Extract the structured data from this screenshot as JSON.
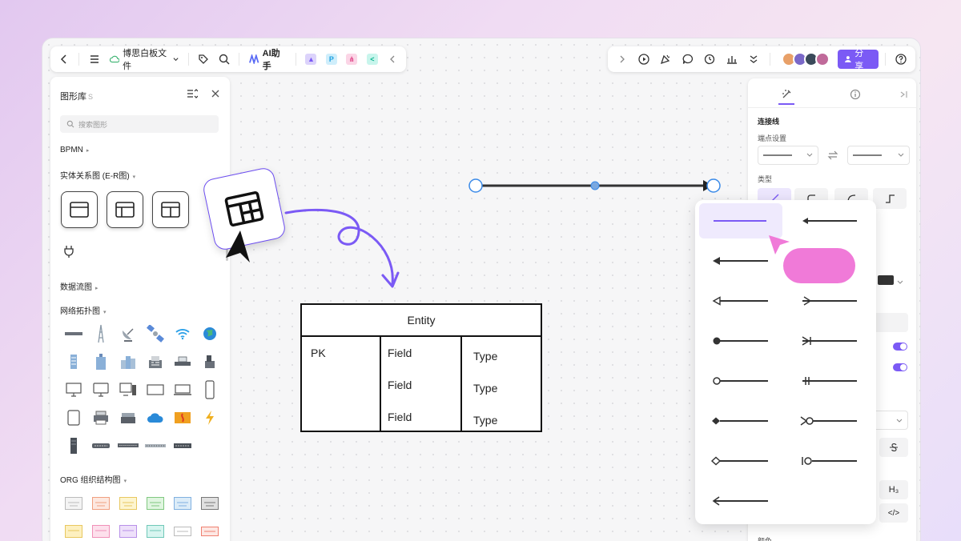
{
  "toolbar": {
    "file_title": "博思白板文件",
    "ai_label": "AI助手",
    "share_label": "分享"
  },
  "library": {
    "title": "图形库",
    "shortcut": "S",
    "search_placeholder": "搜索图形",
    "sections": {
      "bpmn": "BPMN",
      "er": "实体关系图 (E-R图)",
      "dataflow": "数据流图",
      "network": "网络拓扑图",
      "org": "ORG 组织结构图"
    }
  },
  "entity": {
    "title": "Entity",
    "pk": "PK",
    "fields": [
      "Field",
      "Field",
      "Field"
    ],
    "types": [
      "Type",
      "Type",
      "Type"
    ]
  },
  "props": {
    "section_title": "连接线",
    "endpoint_label": "端点设置",
    "type_label": "类型",
    "color_label": "颜色",
    "h3": "H₃",
    "code": "</>"
  },
  "colors": {
    "accent": "#7b5af5",
    "pink": "#f07ad8",
    "arrow_curve": "#7b5af5"
  }
}
